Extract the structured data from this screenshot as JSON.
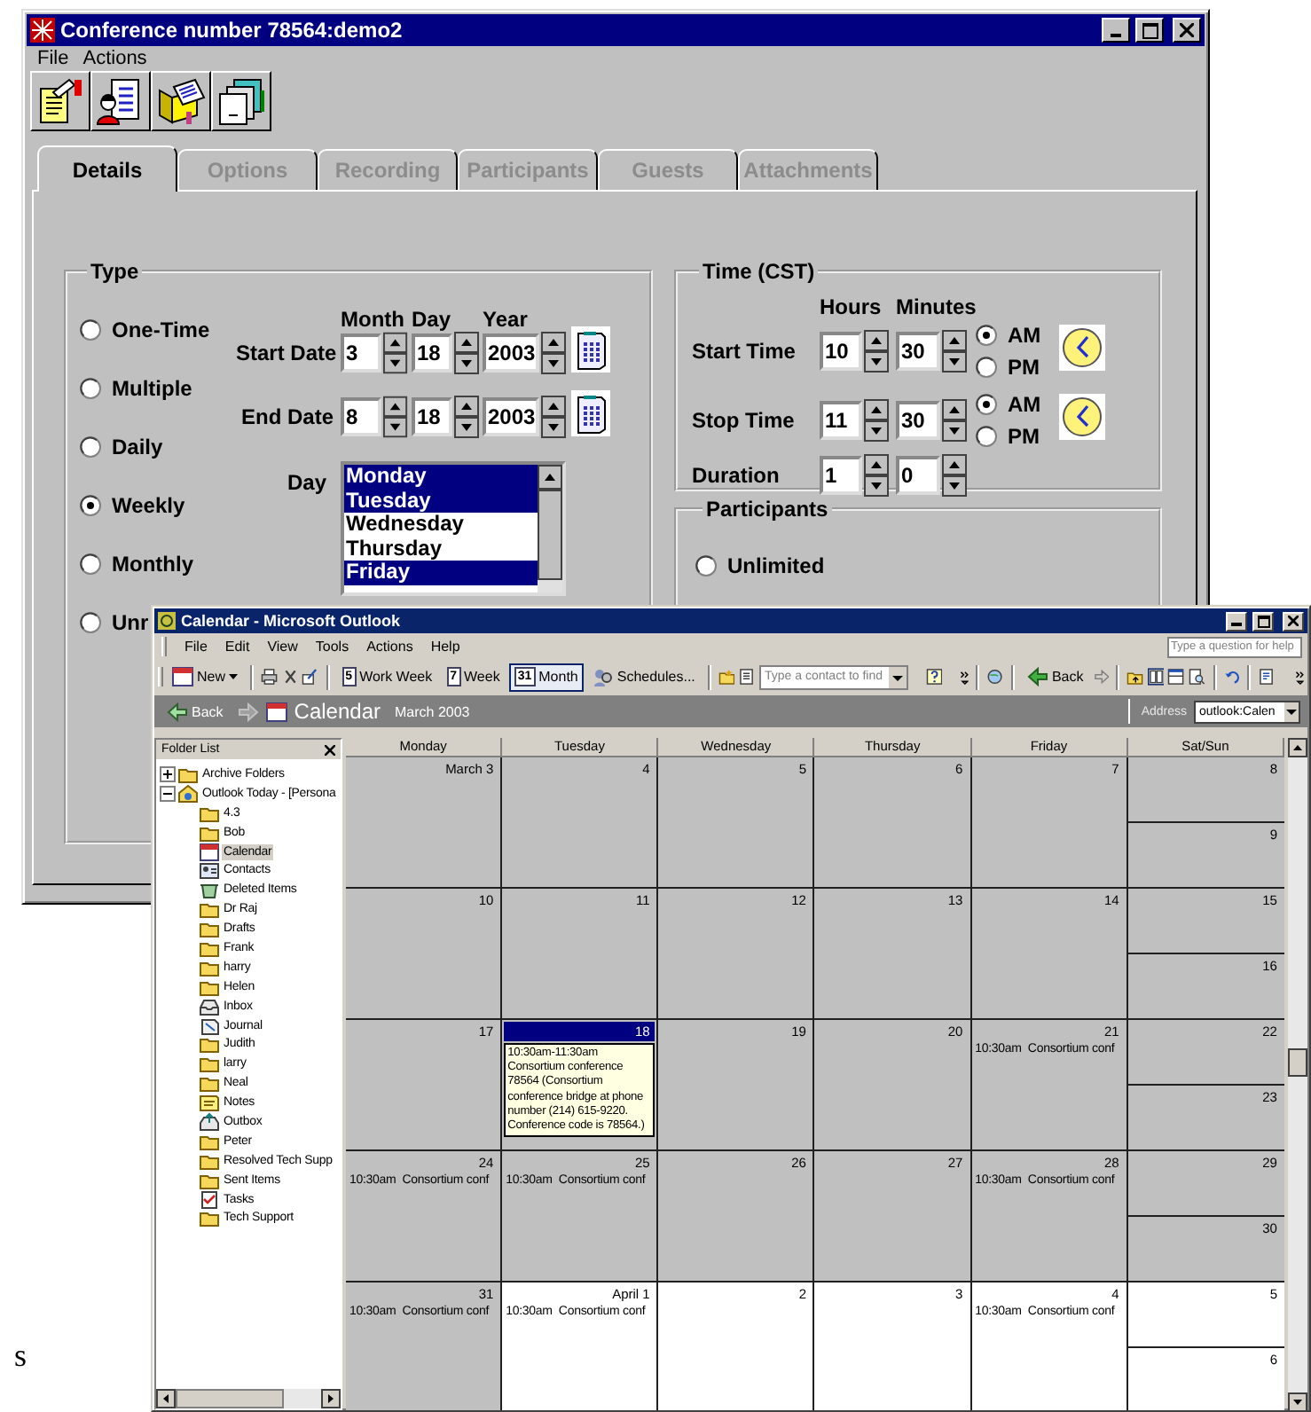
{
  "conference_window": {
    "title": "Conference number 78564:demo2",
    "menu": [
      "File",
      "Actions"
    ],
    "tabs": [
      {
        "label": "Details",
        "selected": true,
        "disabled": false
      },
      {
        "label": "Options",
        "selected": false,
        "disabled": true
      },
      {
        "label": "Recording",
        "selected": false,
        "disabled": true
      },
      {
        "label": "Participants",
        "selected": false,
        "disabled": true
      },
      {
        "label": "Guests",
        "selected": false,
        "disabled": true
      },
      {
        "label": "Attachments",
        "selected": false,
        "disabled": true
      }
    ],
    "type_group": {
      "title": "Type",
      "options": [
        {
          "label": "One-Time",
          "selected": false
        },
        {
          "label": "Multiple",
          "selected": false
        },
        {
          "label": "Daily",
          "selected": false
        },
        {
          "label": "Weekly",
          "selected": true
        },
        {
          "label": "Monthly",
          "selected": false
        },
        {
          "label": "Unr",
          "selected": false
        }
      ],
      "date_headers": [
        "Month",
        "Day",
        "Year"
      ],
      "dates": [
        {
          "label": "Start Date",
          "month": "3",
          "day": "18",
          "year": "2003"
        },
        {
          "label": "End Date",
          "month": "8",
          "day": "18",
          "year": "2003"
        }
      ],
      "day_label": "Day",
      "days": [
        {
          "label": "Monday",
          "selected": true
        },
        {
          "label": "Tuesday",
          "selected": true
        },
        {
          "label": "Wednesday",
          "selected": false
        },
        {
          "label": "Thursday",
          "selected": false
        },
        {
          "label": "Friday",
          "selected": true
        }
      ]
    },
    "time_group": {
      "title": "Time (CST)",
      "headers": [
        "Hours",
        "Minutes"
      ],
      "times": [
        {
          "label": "Start Time",
          "hours": "10",
          "minutes": "30",
          "periods": [
            {
              "label": "AM",
              "selected": true
            },
            {
              "label": "PM",
              "selected": false
            }
          ]
        },
        {
          "label": "Stop Time",
          "hours": "11",
          "minutes": "30",
          "periods": [
            {
              "label": "AM",
              "selected": true
            },
            {
              "label": "PM",
              "selected": false
            }
          ]
        }
      ],
      "duration": {
        "label": "Duration",
        "hours": "1",
        "minutes": "0"
      }
    },
    "participants_group": {
      "title": "Participants",
      "options": [
        {
          "label": "Unlimited",
          "selected": false
        }
      ]
    }
  },
  "outlook_window": {
    "title": "Calendar - Microsoft Outlook",
    "menu": [
      "File",
      "Edit",
      "View",
      "Tools",
      "Actions",
      "Help"
    ],
    "help_placeholder": "Type a question for help",
    "toolbar": {
      "new_label": "New",
      "views": [
        {
          "number": "5",
          "label": "Work Week",
          "selected": false
        },
        {
          "number": "7",
          "label": "Week",
          "selected": false
        },
        {
          "number": "31",
          "label": "Month",
          "selected": true
        }
      ],
      "schedules_label": "Schedules...",
      "contact_placeholder": "Type a contact to find",
      "back_label": "Back"
    },
    "nav_bar": {
      "back_label": "Back",
      "title": "Calendar",
      "subtitle": "March 2003",
      "address_label": "Address",
      "address_value": "outlook:Calen"
    },
    "folder_list": {
      "title": "Folder List",
      "tree": [
        {
          "label": "Archive Folders",
          "kind": "folder",
          "expanded": false,
          "selected": false
        },
        {
          "label": "Outlook Today - [Persona",
          "kind": "root",
          "expanded": true,
          "selected": false,
          "children": [
            {
              "label": "4.3",
              "kind": "folder",
              "selected": false
            },
            {
              "label": "Bob",
              "kind": "folder",
              "selected": false
            },
            {
              "label": "Calendar",
              "kind": "calendar",
              "selected": true
            },
            {
              "label": "Contacts",
              "kind": "contacts",
              "selected": false
            },
            {
              "label": "Deleted Items",
              "kind": "trash",
              "selected": false
            },
            {
              "label": "Dr Raj",
              "kind": "folder",
              "selected": false
            },
            {
              "label": "Drafts",
              "kind": "folder",
              "selected": false
            },
            {
              "label": "Frank",
              "kind": "folder",
              "selected": false
            },
            {
              "label": "harry",
              "kind": "folder",
              "selected": false
            },
            {
              "label": "Helen",
              "kind": "folder",
              "selected": false
            },
            {
              "label": "Inbox",
              "kind": "inbox",
              "selected": false
            },
            {
              "label": "Journal",
              "kind": "journal",
              "selected": false
            },
            {
              "label": "Judith",
              "kind": "folder",
              "selected": false
            },
            {
              "label": "larry",
              "kind": "folder",
              "selected": false
            },
            {
              "label": "Neal",
              "kind": "folder",
              "selected": false
            },
            {
              "label": "Notes",
              "kind": "notes",
              "selected": false
            },
            {
              "label": "Outbox",
              "kind": "outbox",
              "selected": false
            },
            {
              "label": "Peter",
              "kind": "folder",
              "selected": false
            },
            {
              "label": "Resolved Tech Supp",
              "kind": "folder",
              "selected": false
            },
            {
              "label": "Sent Items",
              "kind": "folder",
              "selected": false
            },
            {
              "label": "Tasks",
              "kind": "tasks",
              "selected": false
            },
            {
              "label": "Tech Support",
              "kind": "folder",
              "selected": false
            }
          ]
        }
      ]
    },
    "calendar": {
      "columns": [
        "Monday",
        "Tuesday",
        "Wednesday",
        "Thursday",
        "Friday",
        "Sat/Sun"
      ],
      "weeks": [
        {
          "days": [
            {
              "date": "March 3",
              "shaded": true,
              "selected": false
            },
            {
              "date": "4",
              "shaded": true,
              "selected": false
            },
            {
              "date": "5",
              "shaded": true,
              "selected": false
            },
            {
              "date": "6",
              "shaded": true,
              "selected": false
            },
            {
              "date": "7",
              "shaded": true,
              "selected": false
            }
          ],
          "weekend": [
            {
              "date": "8",
              "shaded": true,
              "selected": false
            },
            {
              "date": "9",
              "shaded": true,
              "selected": false
            }
          ]
        },
        {
          "days": [
            {
              "date": "10",
              "shaded": true,
              "selected": false
            },
            {
              "date": "11",
              "shaded": true,
              "selected": false
            },
            {
              "date": "12",
              "shaded": true,
              "selected": false
            },
            {
              "date": "13",
              "shaded": true,
              "selected": false
            },
            {
              "date": "14",
              "shaded": true,
              "selected": false
            }
          ],
          "weekend": [
            {
              "date": "15",
              "shaded": true,
              "selected": false
            },
            {
              "date": "16",
              "shaded": true,
              "selected": false
            }
          ]
        },
        {
          "days": [
            {
              "date": "17",
              "shaded": true,
              "selected": false
            },
            {
              "date": "18",
              "shaded": true,
              "selected": true,
              "tooltip": "10:30am-11:30am Consortium conference 78564 (Consortium conference bridge at phone number (214) 615-9220. Conference code is 78564.)"
            },
            {
              "date": "19",
              "shaded": true,
              "selected": false
            },
            {
              "date": "20",
              "shaded": true,
              "selected": false
            },
            {
              "date": "21",
              "shaded": true,
              "selected": false,
              "events": [
                "10:30am  Consortium conf"
              ]
            }
          ],
          "weekend": [
            {
              "date": "22",
              "shaded": true,
              "selected": false
            },
            {
              "date": "23",
              "shaded": true,
              "selected": false
            }
          ]
        },
        {
          "days": [
            {
              "date": "24",
              "shaded": true,
              "selected": false,
              "events": [
                "10:30am  Consortium conf"
              ]
            },
            {
              "date": "25",
              "shaded": true,
              "selected": false,
              "events": [
                "10:30am  Consortium conf"
              ]
            },
            {
              "date": "26",
              "shaded": true,
              "selected": false
            },
            {
              "date": "27",
              "shaded": true,
              "selected": false
            },
            {
              "date": "28",
              "shaded": true,
              "selected": false,
              "events": [
                "10:30am  Consortium conf"
              ]
            }
          ],
          "weekend": [
            {
              "date": "29",
              "shaded": true,
              "selected": false
            },
            {
              "date": "30",
              "shaded": true,
              "selected": false
            }
          ]
        },
        {
          "days": [
            {
              "date": "31",
              "shaded": true,
              "selected": false,
              "events": [
                "10:30am  Consortium conf"
              ]
            },
            {
              "date": "April 1",
              "shaded": false,
              "selected": false,
              "events": [
                "10:30am  Consortium conf"
              ]
            },
            {
              "date": "2",
              "shaded": false,
              "selected": false
            },
            {
              "date": "3",
              "shaded": false,
              "selected": false
            },
            {
              "date": "4",
              "shaded": false,
              "selected": false,
              "events": [
                "10:30am  Consortium conf"
              ]
            }
          ],
          "weekend": [
            {
              "date": "5",
              "shaded": false,
              "selected": false
            },
            {
              "date": "6",
              "shaded": false,
              "selected": false
            }
          ]
        }
      ]
    }
  },
  "margin_text": "s"
}
